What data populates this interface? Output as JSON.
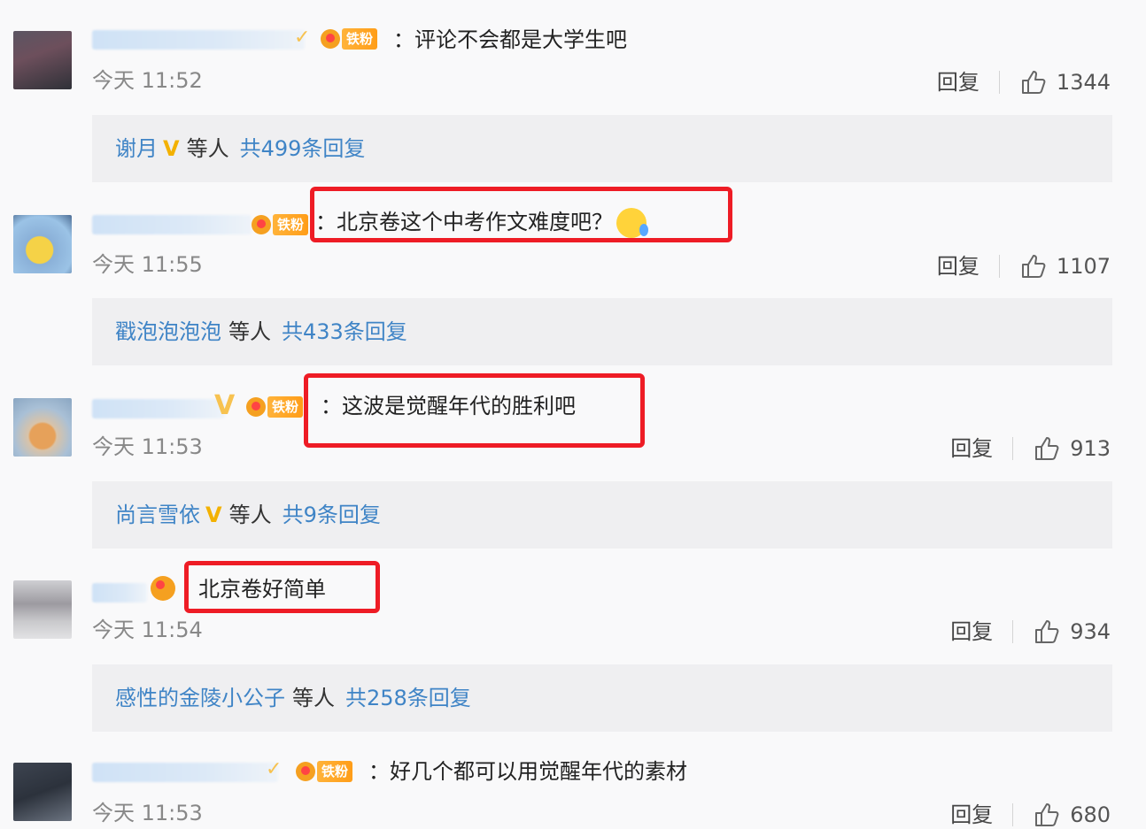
{
  "comments": [
    {
      "text": "：评论不会都是大学生吧",
      "time": "今天 11:52",
      "reply": "回复",
      "likes": "1344",
      "badge": "铁粉",
      "replies": {
        "name": "谢月",
        "mid": "等人",
        "count": "共499条回复"
      }
    },
    {
      "text": "：北京卷这个中考作文难度吧？",
      "time": "今天 11:55",
      "reply": "回复",
      "likes": "1107",
      "badge": "铁粉",
      "replies": {
        "name": "戳泡泡泡泡",
        "mid": "等人",
        "count": "共433条回复"
      }
    },
    {
      "text": "：这波是觉醒年代的胜利吧",
      "time": "今天 11:53",
      "reply": "回复",
      "likes": "913",
      "badge": "铁粉",
      "replies": {
        "name": "尚言雪依",
        "mid": "等人",
        "count": "共9条回复"
      }
    },
    {
      "text": "北京卷好简单",
      "time": "今天 11:54",
      "reply": "回复",
      "likes": "934",
      "replies": {
        "name": "感性的金陵小公子",
        "mid": "等人",
        "count": "共258条回复"
      }
    },
    {
      "text": "：好几个都可以用觉醒年代的素材",
      "time": "今天 11:53",
      "reply": "回复",
      "likes": "680",
      "badge": "铁粉"
    }
  ],
  "colors": {
    "highlight": "#ee1c25",
    "link": "#3f84c6",
    "verified": "#f3b100"
  }
}
